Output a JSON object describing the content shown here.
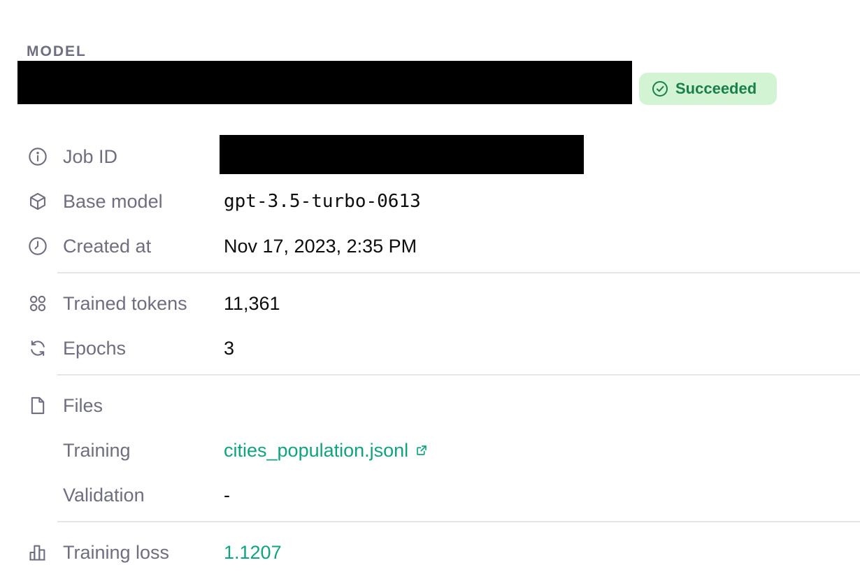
{
  "header": {
    "section_label": "MODEL",
    "status": "Succeeded"
  },
  "details": {
    "job_id": {
      "label": "Job ID"
    },
    "base_model": {
      "label": "Base model",
      "value": "gpt-3.5-turbo-0613"
    },
    "created_at": {
      "label": "Created at",
      "value": "Nov 17, 2023, 2:35 PM"
    },
    "trained_tokens": {
      "label": "Trained tokens",
      "value": "11,361"
    },
    "epochs": {
      "label": "Epochs",
      "value": "3"
    },
    "files": {
      "label": "Files",
      "training_label": "Training",
      "training_value": "cities_population.jsonl",
      "validation_label": "Validation",
      "validation_value": "-"
    },
    "training_loss": {
      "label": "Training loss",
      "value": "1.1207"
    }
  },
  "colors": {
    "accent": "#10a37f",
    "status_bg": "#d2f4d3",
    "status_text": "#1a7f4b",
    "label": "#6e6e80"
  }
}
